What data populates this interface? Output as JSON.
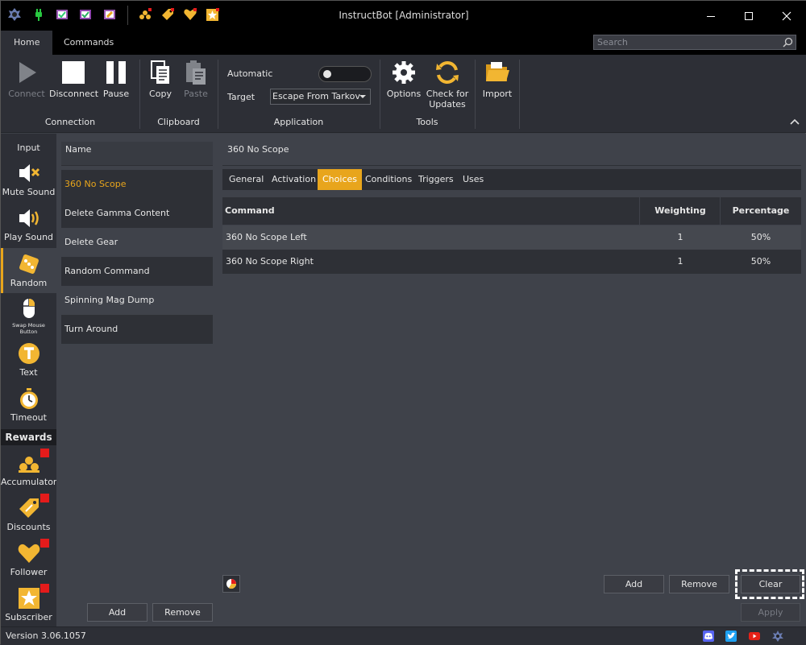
{
  "window": {
    "title": "InstructBot [Administrator]"
  },
  "tabs": [
    "Home",
    "Commands"
  ],
  "search": {
    "placeholder": "Search"
  },
  "ribbon": {
    "connection": {
      "label": "Connection",
      "connect": "Connect",
      "disconnect": "Disconnect",
      "pause": "Pause"
    },
    "clipboard": {
      "label": "Clipboard",
      "copy": "Copy",
      "paste": "Paste"
    },
    "application": {
      "label": "Application",
      "automatic": "Automatic",
      "target": "Target",
      "target_value": "Escape From Tarkov"
    },
    "tools": {
      "label": "Tools",
      "options": "Options",
      "check_line1": "Check for",
      "check_line2": "Updates"
    },
    "import": "Import"
  },
  "sidebar": {
    "items": [
      {
        "label": "Input"
      },
      {
        "label": "Mute Sound"
      },
      {
        "label": "Play Sound"
      },
      {
        "label": "Random"
      },
      {
        "label_line1": "Swap Mouse",
        "label_line2": "Button"
      },
      {
        "label": "Text"
      },
      {
        "label": "Timeout"
      }
    ],
    "rewards_header": "Rewards",
    "rewards": [
      {
        "label": "Accumulator"
      },
      {
        "label": "Discounts"
      },
      {
        "label": "Follower"
      },
      {
        "label": "Subscriber"
      }
    ]
  },
  "list": {
    "header": "Name",
    "items": [
      "360 No Scope",
      "Delete Gamma Content",
      "Delete Gear",
      "Random Command",
      "Spinning Mag Dump",
      "Turn Around"
    ],
    "add": "Add",
    "remove": "Remove"
  },
  "main": {
    "title": "360 No Scope",
    "tabs": [
      "General",
      "Activation",
      "Choices",
      "Conditions",
      "Triggers",
      "Uses"
    ],
    "grid": {
      "columns": [
        "Command",
        "Weighting",
        "Percentage"
      ],
      "rows": [
        [
          "360 No Scope Left",
          "1",
          "50%"
        ],
        [
          "360 No Scope Right",
          "1",
          "50%"
        ]
      ]
    },
    "add": "Add",
    "remove": "Remove",
    "clear": "Clear",
    "apply": "Apply"
  },
  "status": {
    "version": "Version 3.06.1057"
  },
  "colors": {
    "accent": "#e8a51c",
    "badge": "#e41b1b"
  }
}
